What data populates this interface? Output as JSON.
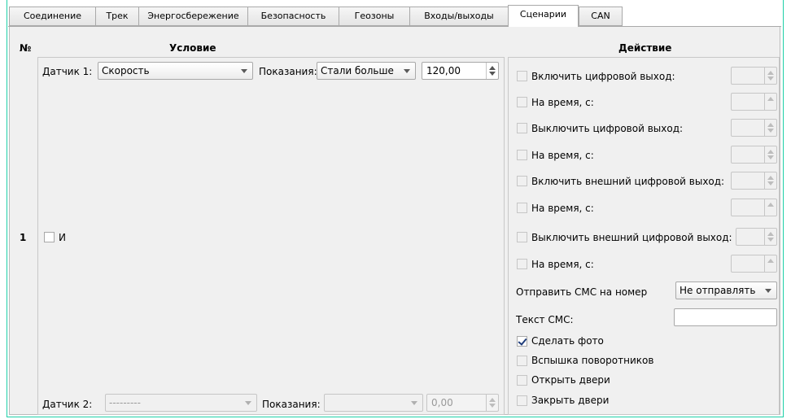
{
  "tabs": [
    {
      "label": "Соединение"
    },
    {
      "label": "Трек"
    },
    {
      "label": "Энергосбережение"
    },
    {
      "label": "Безопасность"
    },
    {
      "label": "Геозоны"
    },
    {
      "label": "Входы/выходы"
    },
    {
      "label": "Сценарии",
      "active": true
    },
    {
      "label": "CAN"
    }
  ],
  "headers": {
    "number": "№",
    "condition": "Условие",
    "action": "Действие"
  },
  "row": {
    "number": "1",
    "and_label": "И",
    "and_checked": false,
    "sensor1": {
      "label": "Датчик 1:",
      "value": "Скорость",
      "reading_label": "Показания:",
      "compare": "Стали больше",
      "threshold": "120,00"
    },
    "sensor2": {
      "label": "Датчик 2:",
      "value": "---------",
      "reading_label": "Показания:",
      "compare": "",
      "threshold": "0,00"
    }
  },
  "actions": {
    "digital_on": {
      "label": "Включить цифровой выход:",
      "checked": false
    },
    "digital_on_time": {
      "label": "На время, с:",
      "checked": false
    },
    "digital_off": {
      "label": "Выключить цифровой выход:",
      "checked": false
    },
    "digital_off_time": {
      "label": "На время, с:",
      "checked": false
    },
    "ext_on": {
      "label": "Включить внешний цифровой выход:",
      "checked": false
    },
    "ext_on_time": {
      "label": "На время, с:",
      "checked": false
    },
    "ext_off": {
      "label": "Выключить внешний цифровой выход:",
      "checked": false
    },
    "ext_off_time": {
      "label": "На время, с:",
      "checked": false
    },
    "sms_number": {
      "label": "Отправить СМС на номер",
      "value": "Не отправлять"
    },
    "sms_text": {
      "label": "Текст СМС:",
      "value": ""
    },
    "photo": {
      "label": "Сделать фото",
      "checked": true
    },
    "blinkers": {
      "label": "Вспышка поворотников",
      "checked": false
    },
    "open_doors": {
      "label": "Открыть двери",
      "checked": false
    },
    "close_doors": {
      "label": "Закрыть двери",
      "checked": false
    }
  },
  "colors": {
    "accent": "#1ed0a8",
    "panel_bg": "#f0f0f0",
    "check": "#1e3c7a"
  }
}
